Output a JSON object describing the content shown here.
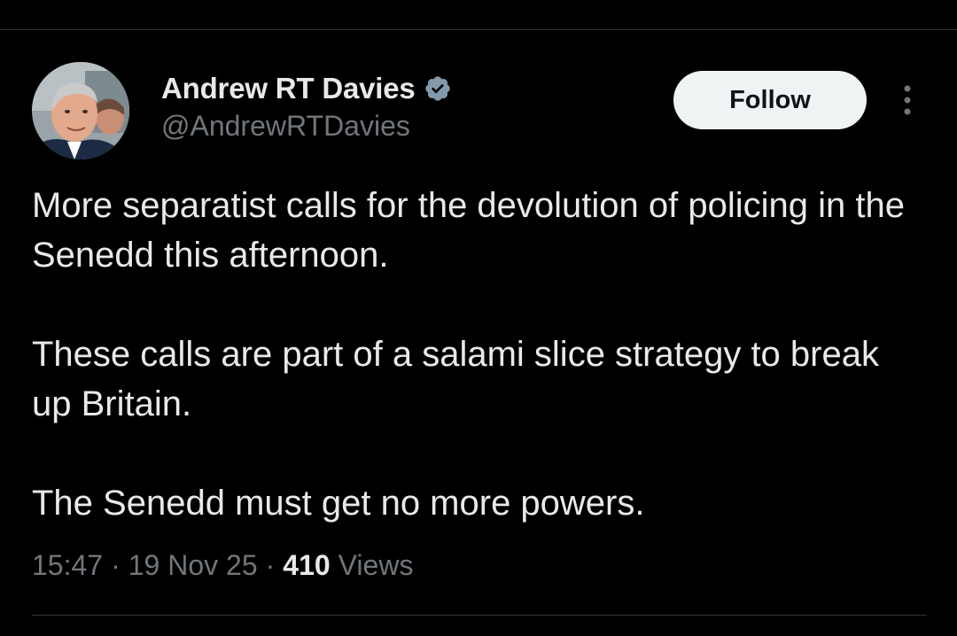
{
  "user": {
    "display_name": "Andrew RT Davies",
    "handle": "@AndrewRTDavies",
    "verified_icon": "verified-badge-icon",
    "verified_color": "#829aab"
  },
  "actions": {
    "follow_label": "Follow",
    "more_icon": "more-vertical-icon"
  },
  "tweet": {
    "paragraphs": [
      "More separatist calls for the devolution of policing in the Senedd this afternoon.",
      "These calls are part of a salami slice strategy to break up Britain.",
      "The Senedd must get no more powers."
    ]
  },
  "meta": {
    "time": "15:47",
    "separator": "·",
    "date": "19 Nov 25",
    "views_count": "410",
    "views_label": "Views"
  },
  "colors": {
    "background": "#000000",
    "text_primary": "#e7e9ea",
    "text_secondary": "#71767b",
    "divider": "#2f3336",
    "follow_bg": "#eff3f4",
    "follow_text": "#0f1419"
  }
}
